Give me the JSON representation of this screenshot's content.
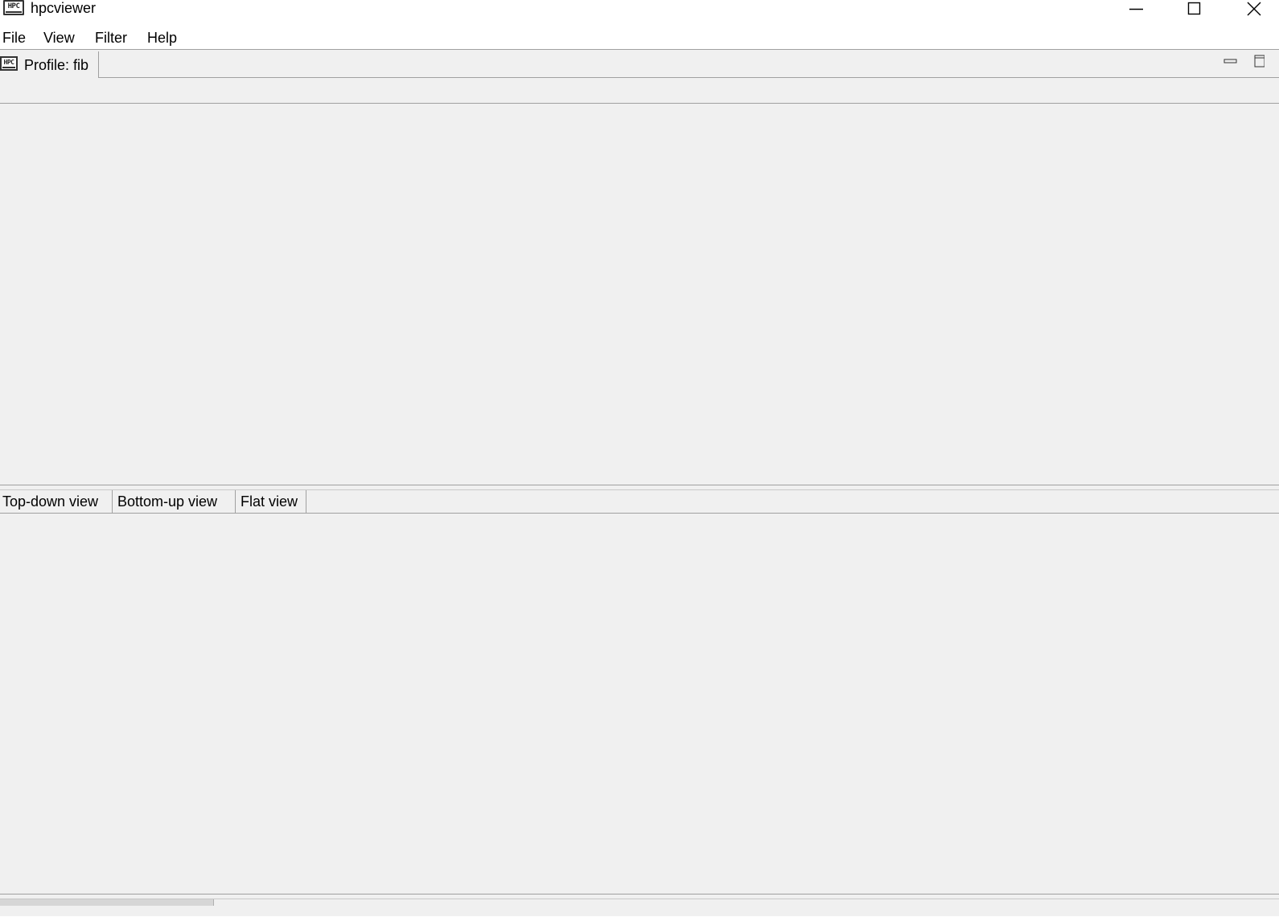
{
  "window": {
    "title": "hpcviewer",
    "icon": "hpc-app-icon",
    "icon_text": "HPC"
  },
  "menu": {
    "items": [
      {
        "label": "File"
      },
      {
        "label": "View"
      },
      {
        "label": "Filter"
      },
      {
        "label": "Help"
      }
    ]
  },
  "editor": {
    "tab_label": "Profile: fib",
    "tab_icon_text": "HPC"
  },
  "views": {
    "tabs": [
      {
        "label": "Top-down view"
      },
      {
        "label": "Bottom-up view"
      },
      {
        "label": "Flat view"
      }
    ]
  },
  "colors": {
    "background": "#f0f0f0",
    "border": "#a0a0a0",
    "titlebar": "#ffffff"
  }
}
